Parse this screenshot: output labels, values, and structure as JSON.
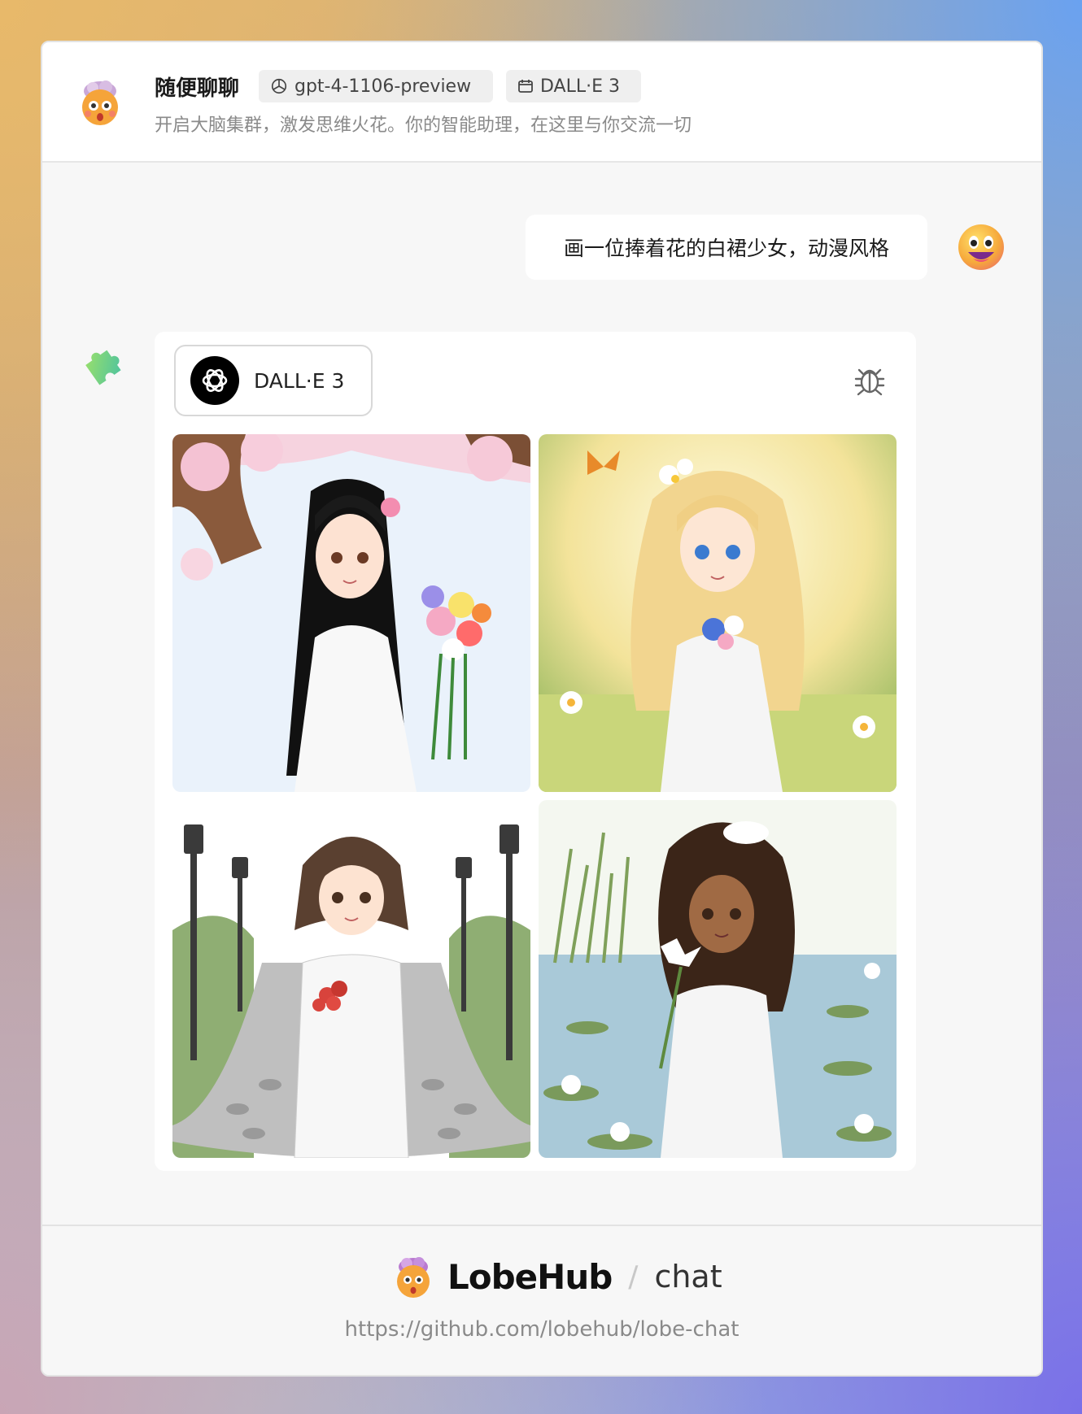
{
  "header": {
    "title": "随便聊聊",
    "model_tag": "gpt-4-1106-preview",
    "plugin_tag": "DALL·E 3",
    "subtitle": "开启大脑集群，激发思维火花。你的智能助理，在这里与你交流一切"
  },
  "messages": {
    "user_text": "画一位捧着花的白裙少女，动漫风格",
    "plugin_name": "DALL·E 3"
  },
  "images": [
    {
      "icon": "anime-girl-black-hair-cherry-blossom-image"
    },
    {
      "icon": "anime-girl-blonde-field-butterflies-image"
    },
    {
      "icon": "anime-girl-short-hair-park-roses-image"
    },
    {
      "icon": "anime-girl-curly-hair-pond-lily-image"
    }
  ],
  "footer": {
    "brand": "LobeHub",
    "separator": "/",
    "product": "chat",
    "url": "https://github.com/lobehub/lobe-chat"
  },
  "colors": {
    "card_bg": "#f7f7f7",
    "bubble_bg": "#ffffff",
    "tag_bg": "#efefef",
    "text_secondary": "#8a8a8a"
  }
}
